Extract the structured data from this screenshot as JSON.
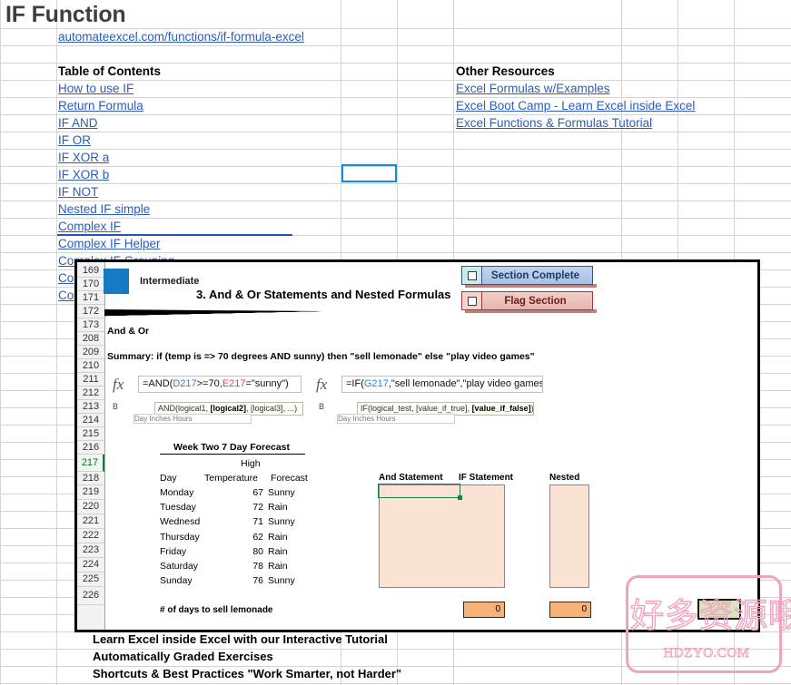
{
  "sheet": {
    "title": "IF Function",
    "url_link": "automateexcel.com/functions/if-formula-excel",
    "toc_heading": "Table of Contents",
    "toc_items": [
      "How to use IF",
      "Return Formula",
      "IF AND",
      "IF OR",
      "IF XOR a",
      "IF XOR b",
      "IF NOT",
      "Nested IF simple",
      "Complex IF",
      "Complex IF Helper",
      "Complex IF Grouping",
      "Co",
      "Co"
    ],
    "resources_heading": "Other Resources",
    "resources": [
      "Excel Formulas w/Examples",
      "Excel Boot Camp - Learn Excel inside Excel",
      "Excel Functions & Formulas Tutorial"
    ],
    "promo_lines": [
      "Learn Excel inside Excel with our Interactive Tutorial",
      "Automatically Graded Exercises",
      "Shortcuts & Best Practices \"Work Smarter, not Harder\""
    ]
  },
  "overlay": {
    "row_headers": [
      "169",
      "170",
      "171",
      "172",
      "173",
      "208",
      "209",
      "210",
      "211",
      "212",
      "213",
      "214",
      "215",
      "216",
      "217",
      "218",
      "219",
      "220",
      "221",
      "222",
      "223",
      "224",
      "225",
      "226"
    ],
    "active_row": "217",
    "badge_label": "Intermediate",
    "title": "3. And & Or Statements and Nested Formulas",
    "subheading": "And & Or",
    "summary": "Summary: if (temp is => 70 degrees AND sunny) then \"sell lemonade\" else \"play video games\"",
    "buttons": {
      "section_complete": "Section Complete",
      "flag_section": "Flag Section"
    },
    "formula_left": {
      "prefix": "=AND(",
      "ref1": "D217",
      "mid": ">=70,",
      "ref2": "E217",
      "suffix": "=\"sunny\")",
      "name_box": "B",
      "tooltip_plain_1": "AND(logical1, ",
      "tooltip_bold": "[logical2]",
      "tooltip_plain_2": ", [logical3], ...)",
      "ghost_row": "Day  Inches  Hours"
    },
    "formula_right": {
      "prefix": "=IF(",
      "ref1": "G217",
      "suffix": ",\"sell lemonade\",\"play video games\")",
      "name_box": "B",
      "tooltip_plain_1": "IF(logical_test, [value_if_true], ",
      "tooltip_bold": "[value_if_false]",
      "tooltip_plain_2": ")",
      "ghost_row": "Day Inches  Hours"
    },
    "forecast": {
      "title": "Week Two 7 Day Forecast",
      "sub_header": "High",
      "columns": [
        "Day",
        "Temperature",
        "Forecast"
      ],
      "rows": [
        {
          "day": "Monday",
          "temp": "67",
          "forecast": "Sunny"
        },
        {
          "day": "Tuesday",
          "temp": "72",
          "forecast": "Rain"
        },
        {
          "day": "Wednesd",
          "temp": "71",
          "forecast": "Sunny"
        },
        {
          "day": "Thursday",
          "temp": "62",
          "forecast": "Rain"
        },
        {
          "day": "Friday",
          "temp": "80",
          "forecast": "Rain"
        },
        {
          "day": "Saturday",
          "temp": "78",
          "forecast": "Rain"
        },
        {
          "day": "Sunday",
          "temp": "76",
          "forecast": "Sunny"
        }
      ],
      "footer": "# of days to sell lemonade"
    },
    "answer_columns": {
      "and_statement": "And Statement",
      "if_statement": "IF Statement",
      "nested": "Nested"
    },
    "totals": [
      "0",
      "0"
    ]
  },
  "watermark": {
    "chinese": "好多资源哦",
    "english": "HDZYO.COM"
  },
  "colors": {
    "link": "#2b5cb8",
    "selection": "#0f8ae8",
    "badge": "#1579c4",
    "answer_fill": "#fae3d2",
    "total_fill": "#f7b27a",
    "watermark": "#f0a3c0",
    "active_row": "#107c41"
  }
}
